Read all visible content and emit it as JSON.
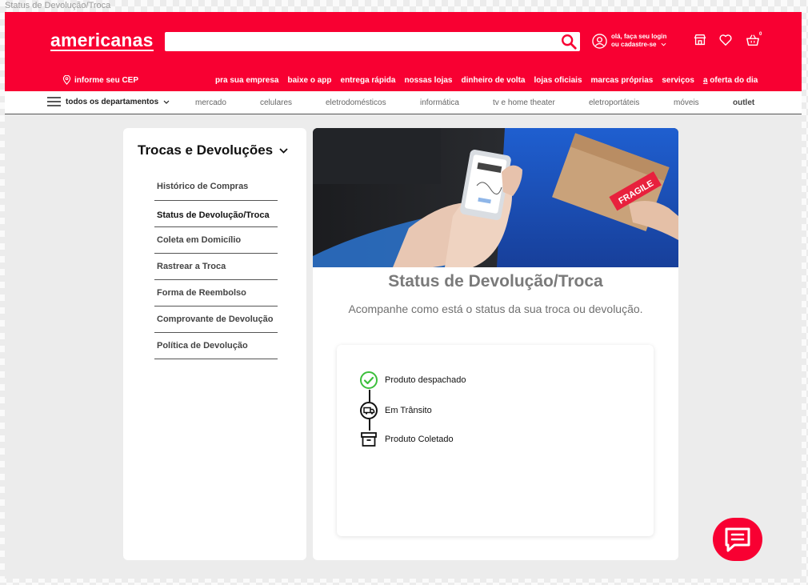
{
  "window": {
    "frame_title": "Status de Devolução/Troca"
  },
  "header": {
    "logo": "americanas",
    "search": {
      "placeholder": "",
      "value": ""
    },
    "login_line1": "olá, faça seu login",
    "login_line2": "ou cadastre-se",
    "cart_count": "0",
    "cep_label": "informe seu CEP",
    "quick_links": [
      "pra sua empresa",
      "baixe o app",
      "entrega rápida",
      "nossas lojas",
      "dinheiro de volta",
      "lojas oficiais",
      "marcas próprias",
      "serviços",
      "oferta do dia"
    ],
    "offer_badge": "a",
    "brand_color": "#f80032"
  },
  "departments": {
    "all_label": "todos os departamentos",
    "items": [
      "mercado",
      "celulares",
      "eletrodomésticos",
      "informática",
      "tv e home theater",
      "eletroportáteis",
      "móveis",
      "outlet"
    ]
  },
  "sidebar": {
    "title": "Trocas e Devoluções",
    "items": [
      {
        "label": "Histórico de Compras"
      },
      {
        "label": "Status de Devolução/Troca"
      },
      {
        "label": "Coleta em Domicílio"
      },
      {
        "label": "Rastrear a Troca"
      },
      {
        "label": "Forma de Reembolso"
      },
      {
        "label": "Comprovante de Devolução"
      },
      {
        "label": "Política de Devolução"
      }
    ],
    "active_index": 1
  },
  "main": {
    "title": "Status de Devolução/Troca",
    "subtitle": "Acompanhe como está o status da sua troca ou devolução.",
    "hero_package_label": "FRAGILE",
    "steps": [
      {
        "label": "Produto despachado",
        "icon": "check-circle-icon",
        "done": true
      },
      {
        "label": "Em Trânsito",
        "icon": "truck-icon",
        "done": false
      },
      {
        "label": "Produto Coletado",
        "icon": "archive-box-icon",
        "done": false
      }
    ],
    "success_color": "#3cbf3c"
  },
  "chat": {
    "icon": "chat-bubble-icon"
  }
}
